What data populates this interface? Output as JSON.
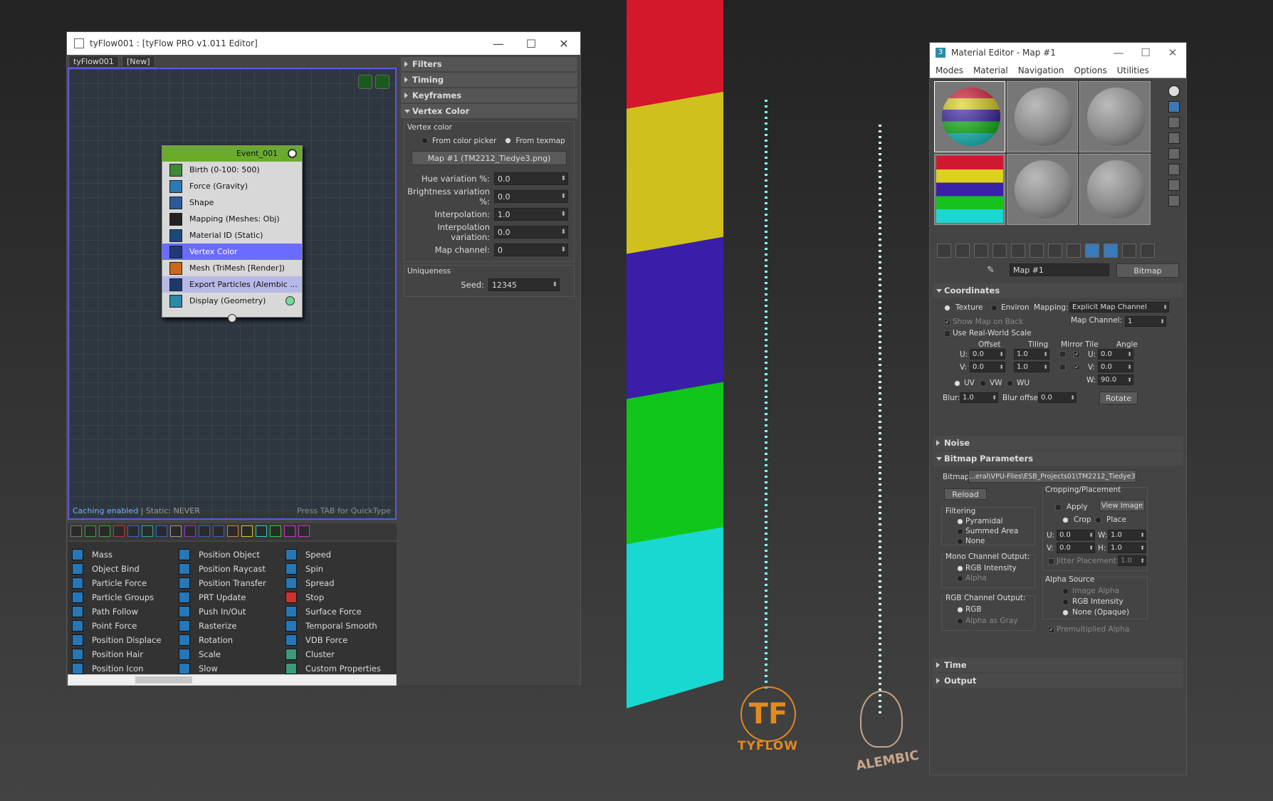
{
  "tyflow": {
    "title": "tyFlow001 : [tyFlow PRO v1.011 Editor]",
    "tabs": [
      "tyFlow001",
      "[New]"
    ],
    "event": {
      "name": "Event_001",
      "operators": [
        "Birth (0-100: 500)",
        "Force (Gravity)",
        "Shape",
        "Mapping (Meshes: Obj)",
        "Material ID (Static)",
        "Vertex Color",
        "Mesh (TriMesh [Render])",
        "Export Particles (Alembic ...",
        "Display (Geometry)"
      ]
    },
    "status_caching": "Caching enabled",
    "status_static": " | Static: NEVER",
    "status_hint": "Press TAB for QuickType",
    "op_list": {
      "col1": [
        "Mass",
        "Object Bind",
        "Particle Force",
        "Particle Groups",
        "Path Follow",
        "Point Force",
        "Position Displace",
        "Position Hair",
        "Position Icon"
      ],
      "col2": [
        "Position Object",
        "Position Raycast",
        "Position Transfer",
        "PRT Update",
        "Push In/Out",
        "Rasterize",
        "Rotation",
        "Scale",
        "Slow"
      ],
      "col3": [
        "Speed",
        "Spin",
        "Spread",
        "Stop",
        "Surface Force",
        "Temporal Smooth",
        "VDB Force",
        "Cluster",
        "Custom Properties"
      ]
    },
    "rollouts": {
      "filters": "Filters",
      "timing": "Timing",
      "keyframes": "Keyframes",
      "vertex_color": "Vertex Color"
    },
    "vertex_color": {
      "group_label": "Vertex color",
      "opt_picker": "From color picker",
      "opt_texmap": "From texmap",
      "map_button": "Map #1 (TM2212_Tiedye3.png)",
      "hue_label": "Hue variation %:",
      "hue_value": "0.0",
      "bright_label": "Brightness variation %:",
      "bright_value": "0.0",
      "interp_label": "Interpolation:",
      "interp_value": "1.0",
      "interpvar_label": "Interpolation variation:",
      "interpvar_value": "0.0",
      "mapch_label": "Map channel:",
      "mapch_value": "0",
      "uniq_label": "Uniqueness",
      "seed_label": "Seed:",
      "seed_value": "12345"
    }
  },
  "logos": {
    "tyflow": "TYFLOW",
    "alembic": "ALEMBIC"
  },
  "material_editor": {
    "title": "Material Editor - Map #1",
    "menu": [
      "Modes",
      "Material",
      "Navigation",
      "Options",
      "Utilities"
    ],
    "map_name": "Map #1",
    "map_type": "Bitmap",
    "coordinates": {
      "rollout": "Coordinates",
      "texture": "Texture",
      "environ": "Environ",
      "mapping_label": "Mapping:",
      "mapping_value": "Explicit Map Channel",
      "show_map_back": "Show Map on Back",
      "map_channel_label": "Map Channel:",
      "map_channel_value": "1",
      "real_world": "Use Real-World Scale",
      "offset": "Offset",
      "tiling": "Tiling",
      "mirror_tile": "Mirror Tile",
      "angle": "Angle",
      "u_label": "U:",
      "v_label": "V:",
      "w_label": "W:",
      "u_offset": "0.0",
      "v_offset": "0.0",
      "u_tiling": "1.0",
      "v_tiling": "1.0",
      "u_angle": "0.0",
      "v_angle": "0.0",
      "w_angle": "90.0",
      "uv": "UV",
      "vw": "VW",
      "wu": "WU",
      "blur_label": "Blur:",
      "blur_value": "1.0",
      "bluroff_label": "Blur offset:",
      "bluroff_value": "0.0",
      "rotate": "Rotate"
    },
    "noise": "Noise",
    "bitmap_params": {
      "rollout": "Bitmap Parameters",
      "bitmap_label": "Bitmap:",
      "bitmap_path": "...eral\\VPU-Files\\ESB_Projects01\\TM2212_Tiedye3.png",
      "reload": "Reload",
      "cropping": "Cropping/Placement",
      "apply": "Apply",
      "view_image": "View Image",
      "crop": "Crop",
      "place": "Place",
      "filtering": "Filtering",
      "pyramidal": "Pyramidal",
      "summed": "Summed Area",
      "none": "None",
      "u_val": "0.0",
      "v_val": "0.0",
      "w_val": "1.0",
      "h_val": "1.0",
      "w_label": "W:",
      "h_label": "H:",
      "jitter": "Jitter Placement:",
      "jitter_val": "1.0",
      "mono": "Mono Channel Output:",
      "rgb_intensity": "RGB Intensity",
      "alpha": "Alpha",
      "alpha_source": "Alpha Source",
      "image_alpha": "Image Alpha",
      "rgb_intensity2": "RGB Intensity",
      "none_opaque": "None (Opaque)",
      "rgb_channel": "RGB Channel Output:",
      "rgb": "RGB",
      "alpha_gray": "Alpha as Gray",
      "premult": "Premultiplied Alpha"
    },
    "time": "Time",
    "output": "Output"
  }
}
